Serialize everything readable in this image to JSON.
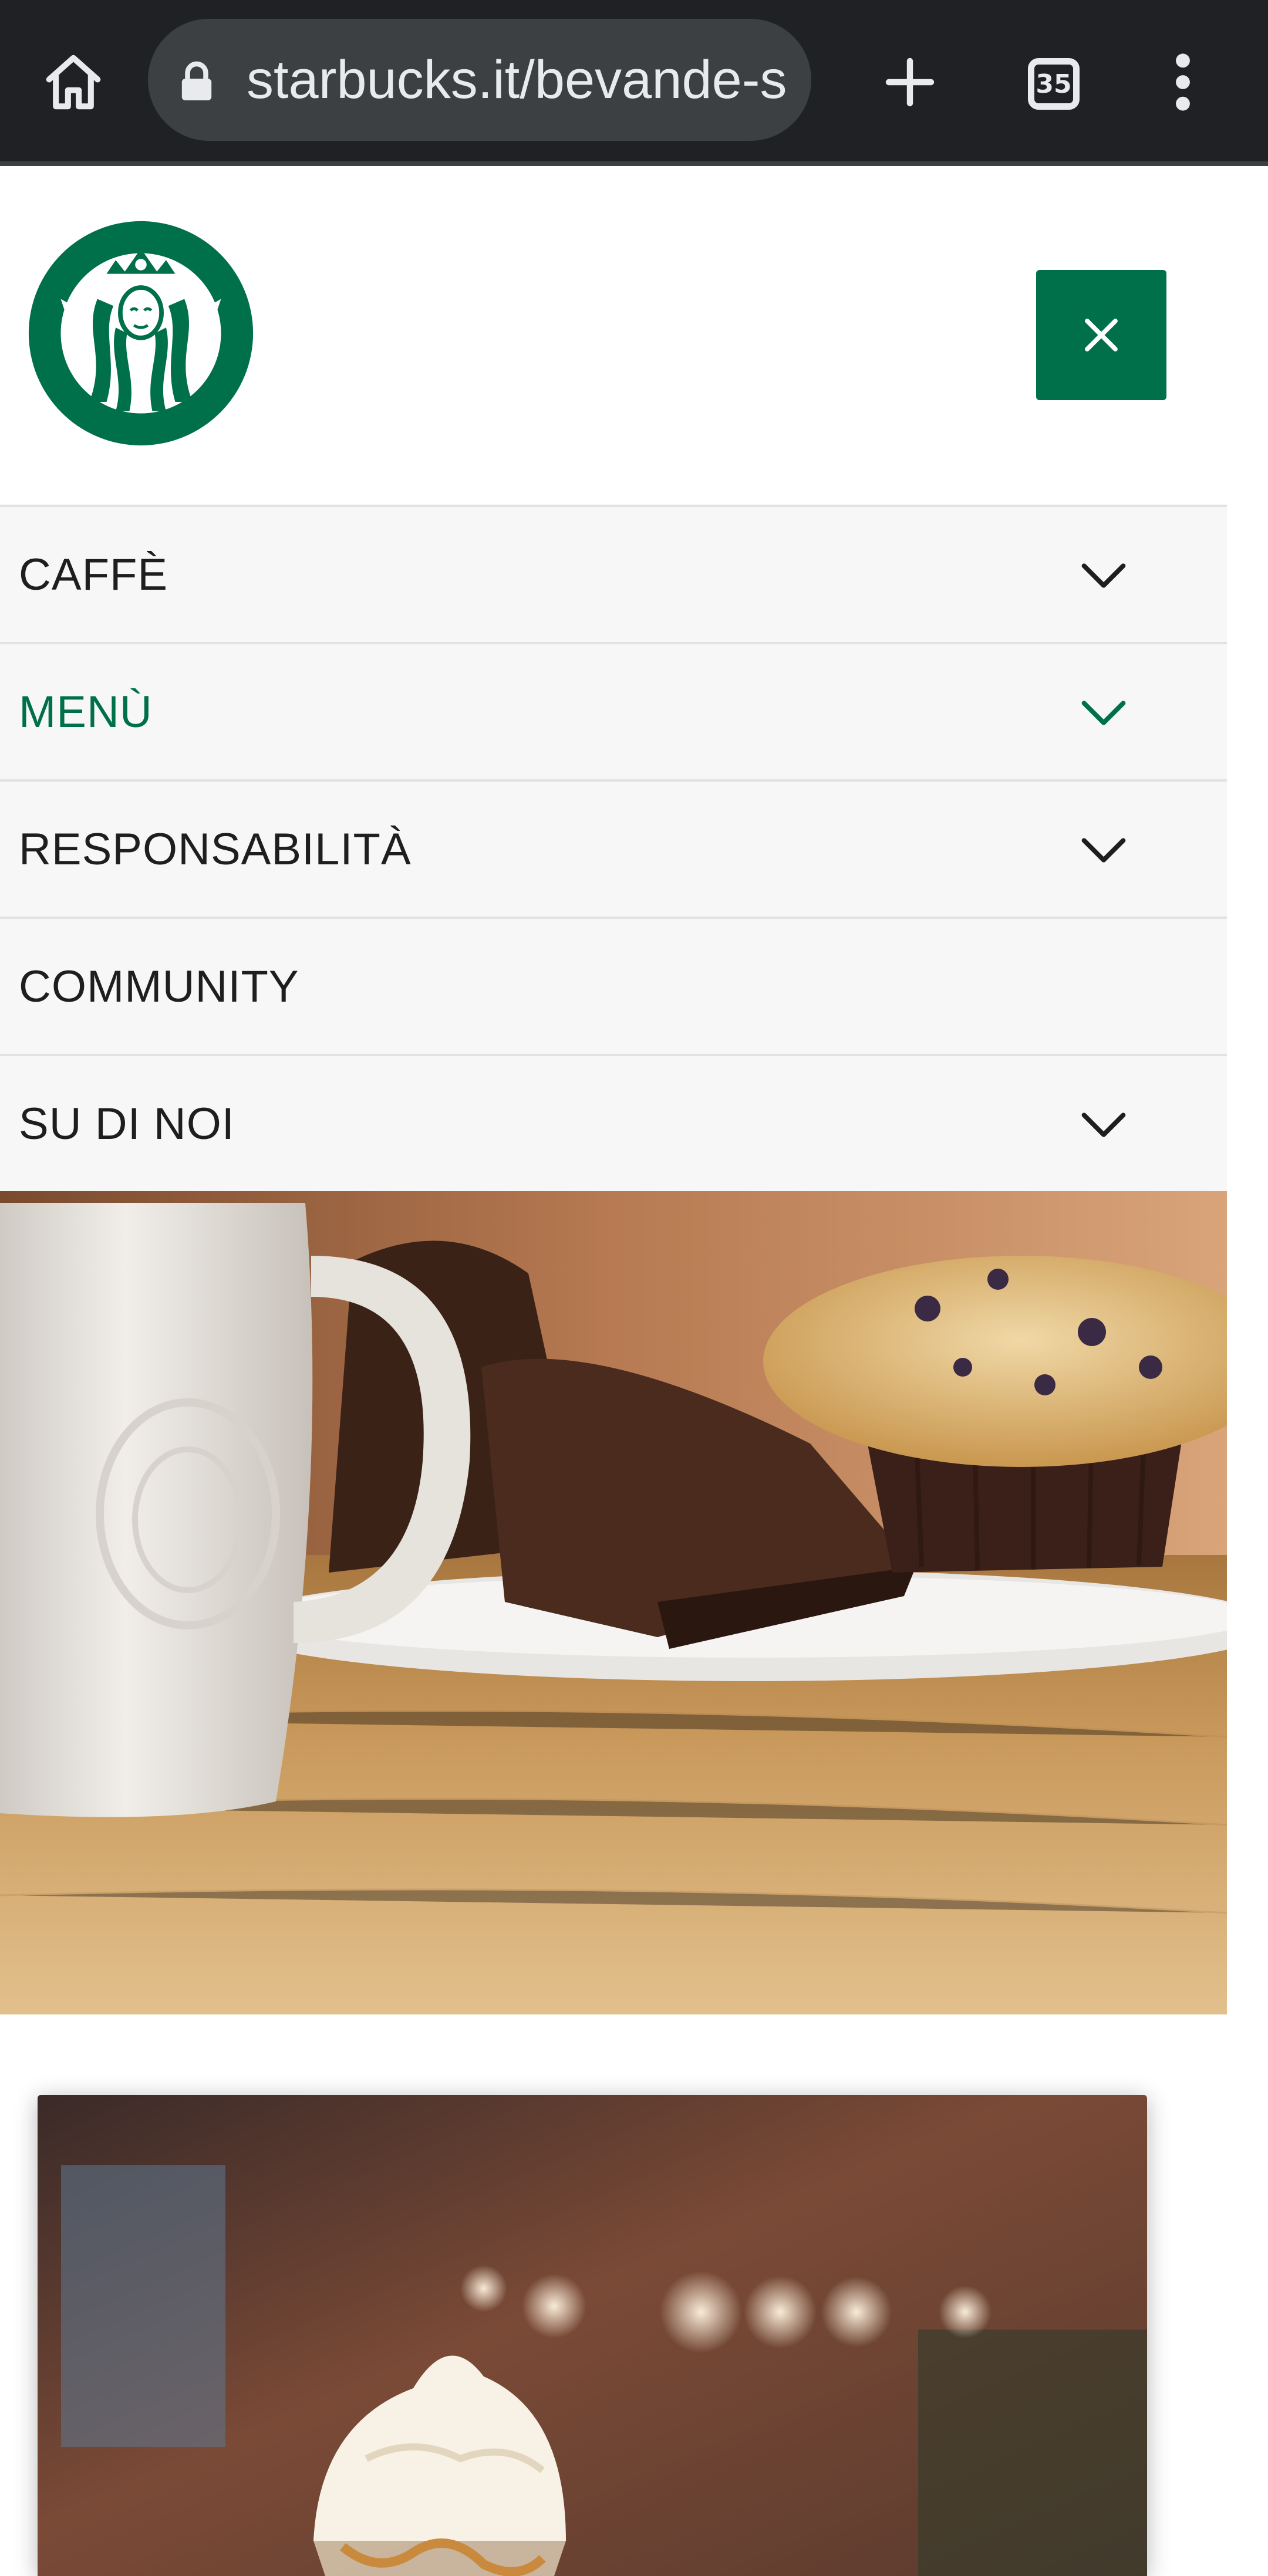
{
  "browser": {
    "url": "starbucks.it/bevande-s",
    "tab_count": "35",
    "icons": [
      "home-icon",
      "lock-icon",
      "plus-icon",
      "tabs-icon",
      "overflow-menu-icon"
    ]
  },
  "header": {
    "logo": "starbucks-siren-logo",
    "close_icon": "close-icon"
  },
  "nav": {
    "items": [
      {
        "label": "CAFFÈ",
        "has_chevron": true,
        "active": false
      },
      {
        "label": "MENÙ",
        "has_chevron": true,
        "active": true
      },
      {
        "label": "RESPONSABILITÀ",
        "has_chevron": true,
        "active": false
      },
      {
        "label": "COMMUNITY",
        "has_chevron": false,
        "active": false
      },
      {
        "label": "SU DI NOI",
        "has_chevron": true,
        "active": false
      }
    ]
  },
  "images": {
    "hero": "mug-chocolate-cake-muffin-photo",
    "card": "frappuccino-photo"
  },
  "colors": {
    "brand_green": "#00704a",
    "browser_bg": "#202124",
    "nav_bg": "#f7f7f7",
    "nav_text": "#1e1e1e"
  }
}
